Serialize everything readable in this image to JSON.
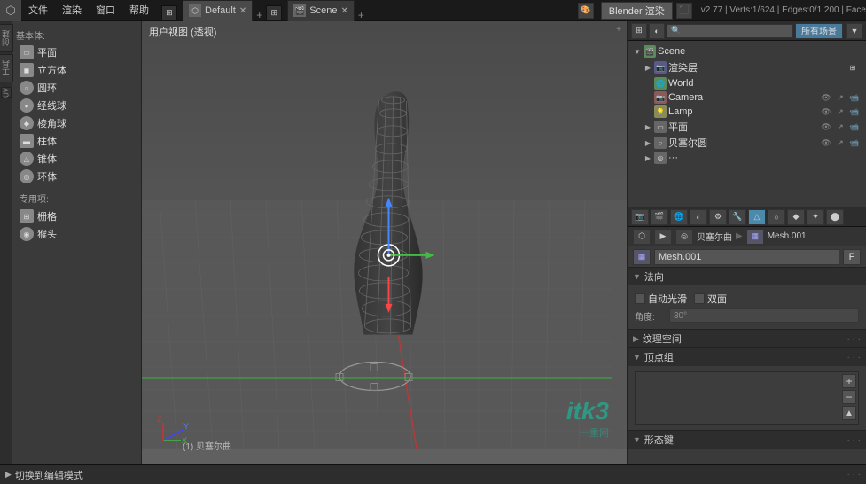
{
  "topbar": {
    "blender_icon": "⬡",
    "menus": [
      "文件",
      "渲染",
      "窗口",
      "帮助"
    ],
    "tabs": [
      {
        "label": "Default",
        "active": true
      },
      {
        "label": "Scene",
        "active": false
      }
    ],
    "render_engine": "Blender 渲染",
    "version": "v2.77 | Verts:1/624 | Edges:0/1,200 | Face"
  },
  "left_panel": {
    "section_basic": "基本体:",
    "primitives": [
      {
        "icon": "▭",
        "label": "平面",
        "shape": "square"
      },
      {
        "icon": "◼",
        "label": "立方体",
        "shape": "square"
      },
      {
        "icon": "○",
        "label": "圆环",
        "shape": "circle"
      },
      {
        "icon": "●",
        "label": "经线球",
        "shape": "circle"
      },
      {
        "icon": "◆",
        "label": "棱角球",
        "shape": "circle"
      },
      {
        "icon": "▬",
        "label": "柱体",
        "shape": "square"
      },
      {
        "icon": "△",
        "label": "锥体",
        "shape": "triangle"
      },
      {
        "icon": "◎",
        "label": "环体",
        "shape": "circle"
      }
    ],
    "section_special": "专用项:",
    "specials": [
      {
        "icon": "⊞",
        "label": "栅格"
      },
      {
        "icon": "◉",
        "label": "猴头"
      }
    ],
    "side_tabs": [
      "创建",
      "工具"
    ],
    "toggle_edit": "切换到编辑模式"
  },
  "viewport": {
    "title": "用户视图 (透视)",
    "object_label": "(1) 贝塞尔曲",
    "axes": {
      "x": "X",
      "y": "Y",
      "z": "Z"
    }
  },
  "outliner": {
    "search_placeholder": "所有场景",
    "scene_label": "Scene",
    "items": [
      {
        "label": "渲染层",
        "icon": "📷",
        "level": 1,
        "has_arrow": true
      },
      {
        "label": "World",
        "icon": "🌐",
        "level": 1,
        "has_arrow": false
      },
      {
        "label": "Camera",
        "icon": "📷",
        "level": 1,
        "has_arrow": false
      },
      {
        "label": "Lamp",
        "icon": "💡",
        "level": 1,
        "has_arrow": false
      },
      {
        "label": "平面",
        "icon": "▭",
        "level": 1,
        "has_arrow": false
      },
      {
        "label": "贝塞尔圆",
        "icon": "○",
        "level": 1,
        "has_arrow": false
      },
      {
        "label": "...",
        "icon": "",
        "level": 1,
        "has_arrow": false
      }
    ]
  },
  "properties": {
    "breadcrumb": [
      "贝塞尔曲",
      "Mesh.001"
    ],
    "breadcrumb_sep": "▶",
    "mesh_name": "Mesh.001",
    "f_label": "F",
    "sections": {
      "normals": {
        "title": "法向",
        "auto_smooth": "自动光滑",
        "double_sided": "双面",
        "angle_label": "角度:",
        "angle_value": "30°"
      },
      "texture_space": {
        "title": "纹理空间"
      },
      "vertex_groups": {
        "title": "顶点组"
      },
      "shape_keys": {
        "title": "形态键"
      }
    }
  },
  "props_toolbar": {
    "icons": [
      "⬡",
      "○",
      "▦",
      "◐",
      "⚙",
      "📐",
      "⊡",
      "⊞",
      "⬤"
    ]
  },
  "watermark": {
    "text": "itk3",
    "subtext": "一重网"
  }
}
